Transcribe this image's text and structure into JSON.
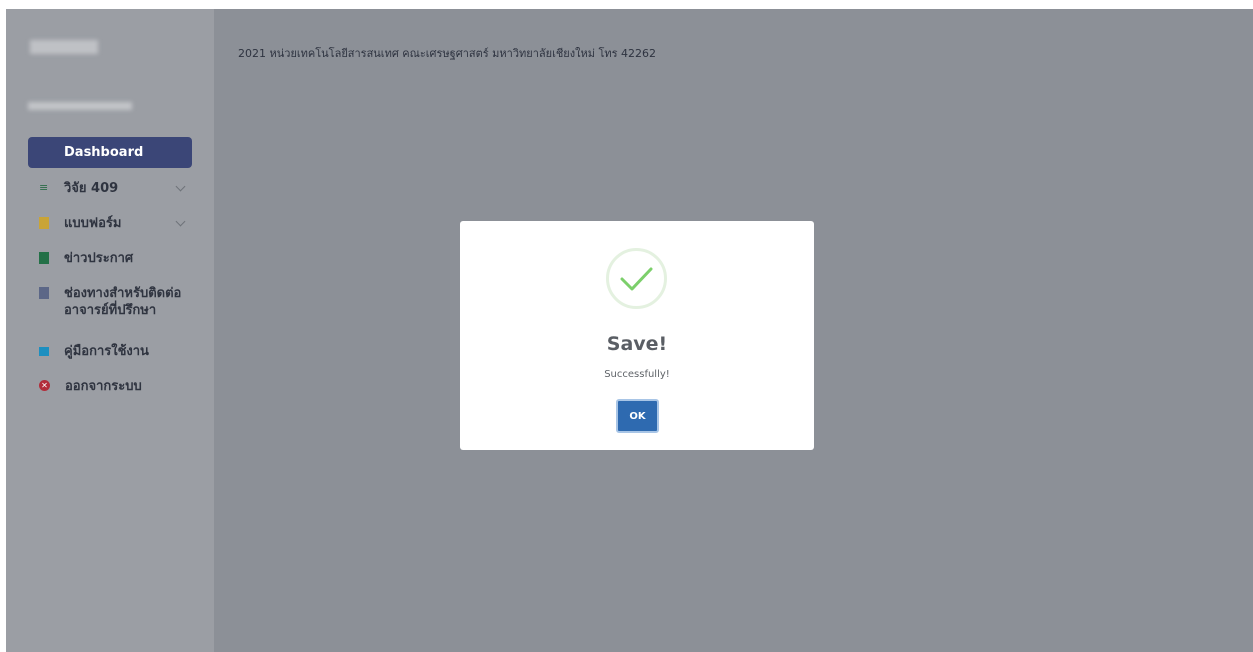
{
  "footer": {
    "text": "2021 หน่วยเทคโนโลยีสารสนเทศ คณะเศรษฐศาสตร์ มหาวิทยาลัยเชียงใหม่ โทร 42262"
  },
  "sidebar": {
    "items": [
      {
        "label": "Dashboard",
        "icon": "dashboard-grid-icon",
        "active": true
      },
      {
        "label": "วิจัย 409",
        "icon": "layers-icon",
        "has_submenu": true
      },
      {
        "label": "แบบฟอร์ม",
        "icon": "form-icon",
        "has_submenu": true
      },
      {
        "label": "ข่าวประกาศ",
        "icon": "news-icon"
      },
      {
        "label": "ช่องทางสำหรับติดต่ออาจารย์ที่ปรึกษา",
        "icon": "contact-advisor-icon"
      },
      {
        "label": "คู่มือการใช้งาน",
        "icon": "book-icon"
      },
      {
        "label": "ออกจากระบบ",
        "icon": "logout-icon"
      }
    ]
  },
  "modal": {
    "icon": "success-check-icon",
    "title": "Save!",
    "text": "Successfully!",
    "ok_label": "OK"
  },
  "colors": {
    "overlay_main": "#8c9097",
    "overlay_sidebar": "#9b9ea4",
    "active_item": "#3b4677",
    "ok_button": "#2e6ab0",
    "success_check": "#7ccf6b"
  }
}
